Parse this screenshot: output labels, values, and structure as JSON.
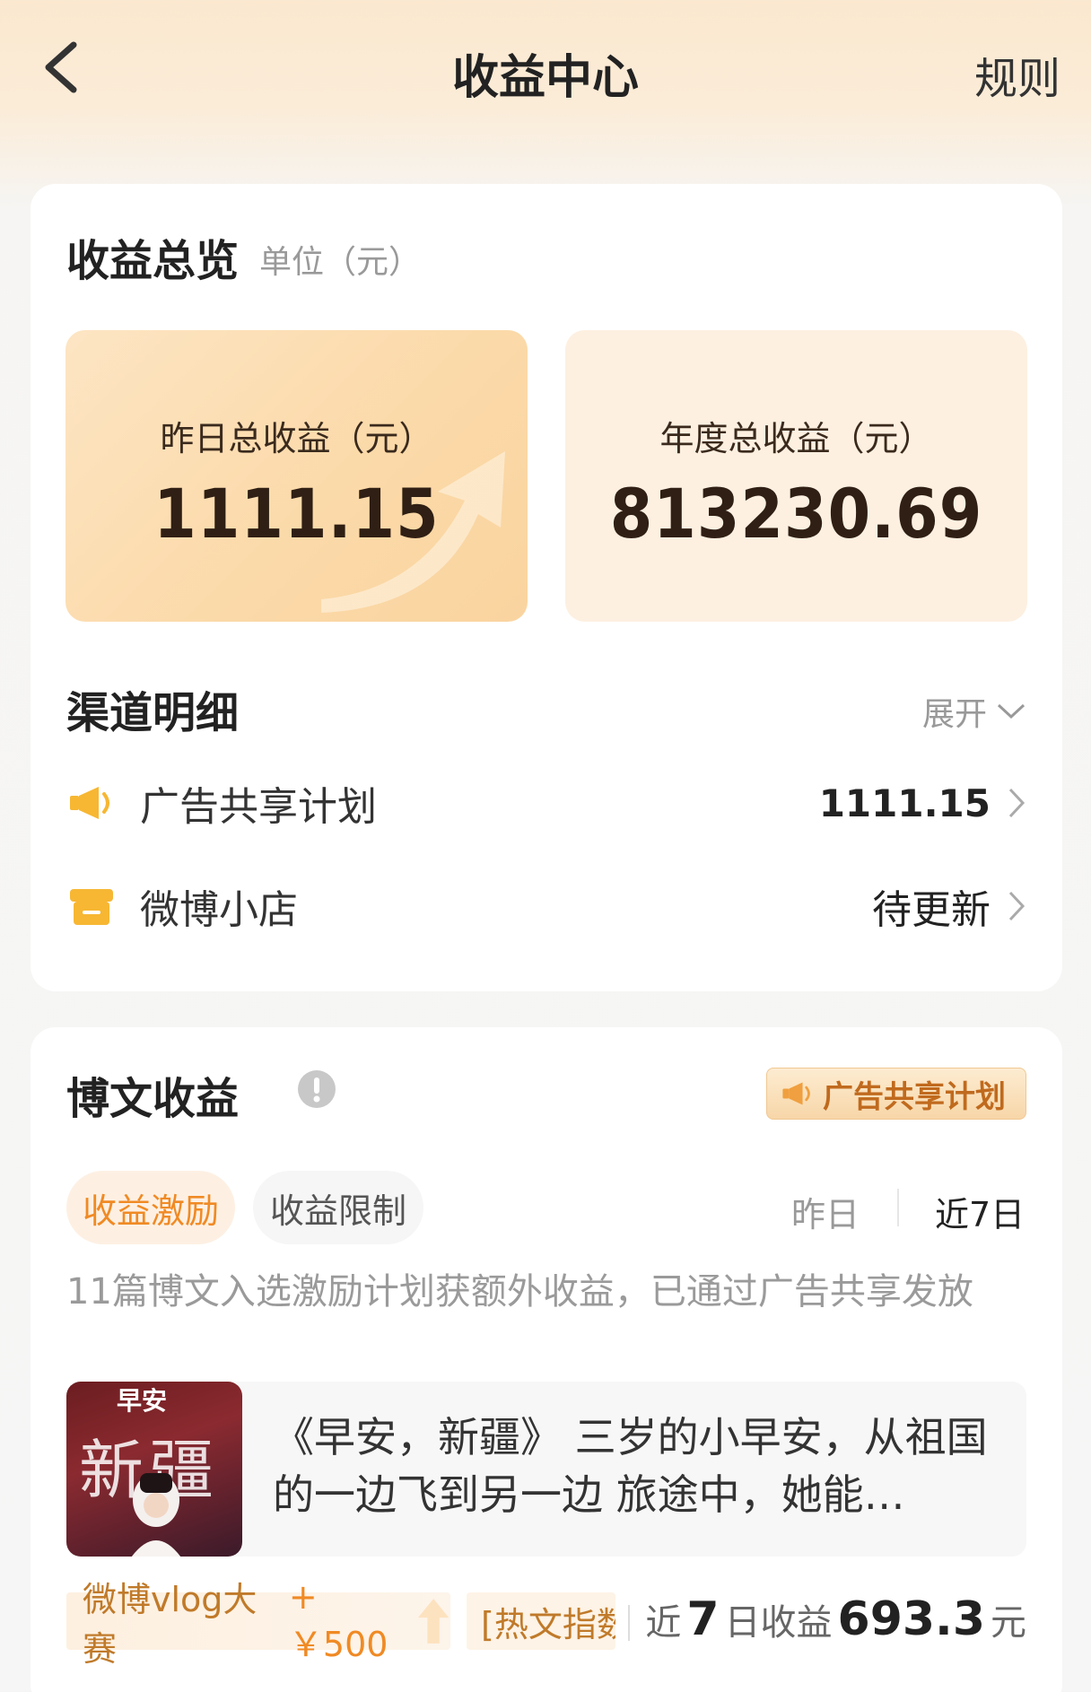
{
  "header": {
    "title": "收益中心",
    "rules_label": "规则"
  },
  "overview": {
    "title": "收益总览",
    "unit": "单位（元）",
    "yesterday_label": "昨日总收益（元）",
    "yesterday_value": "1111.15",
    "annual_label": "年度总收益（元）",
    "annual_value": "813230.69"
  },
  "channels": {
    "title": "渠道明细",
    "expand_label": "展开",
    "items": [
      {
        "label": "广告共享计划",
        "value": "1111.15",
        "icon": "megaphone-icon"
      },
      {
        "label": "微博小店",
        "value": "待更新",
        "icon": "shop-icon"
      }
    ]
  },
  "post_earnings": {
    "title": "博文收益",
    "badge_label": "广告共享计划",
    "tabs": [
      {
        "label": "收益激励",
        "active": true
      },
      {
        "label": "收益限制",
        "active": false
      }
    ],
    "periods": [
      {
        "label": "昨日",
        "active": false
      },
      {
        "label": "近7日",
        "active": true
      }
    ],
    "description": "11篇博文入选激励计划获额外收益，已通过广告共享发放",
    "post": {
      "thumb_top_text": "早安",
      "thumb_word": "新疆",
      "text": "《早安，新疆》 三岁的小早安，从祖国的一边飞到另一边 旅途中，她能…"
    },
    "tags": {
      "vlog": "微博vlog大赛",
      "vlog_bonus": "+￥500",
      "hot": "[热文指数"
    },
    "week_earn": {
      "prefix": "近",
      "days": "7",
      "middle": "日收益",
      "amount": "693.3",
      "suffix": "元"
    }
  },
  "colors": {
    "accent": "#f08a24",
    "badge_text": "#c06a1e",
    "icon_yellow": "#f7b733"
  }
}
